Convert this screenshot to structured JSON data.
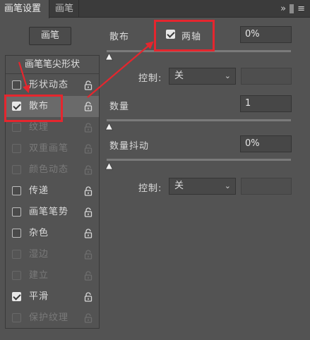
{
  "tabs": [
    {
      "label": "画笔设置",
      "active": true
    },
    {
      "label": "画笔",
      "active": false
    }
  ],
  "tabbar": {
    "collapse_icon": "double-chevron-right-icon",
    "menu_icon": "hamburger-menu-icon"
  },
  "brush_button": {
    "label": "画笔"
  },
  "tip_shape": {
    "label": "画笔笔尖形状"
  },
  "options": [
    {
      "label": "形状动态",
      "checked": false,
      "enabled": true
    },
    {
      "label": "散布",
      "checked": true,
      "enabled": true,
      "selected": true
    },
    {
      "label": "纹理",
      "checked": false,
      "enabled": false
    },
    {
      "label": "双重画笔",
      "checked": false,
      "enabled": false
    },
    {
      "label": "颜色动态",
      "checked": false,
      "enabled": false
    },
    {
      "label": "传递",
      "checked": false,
      "enabled": true
    },
    {
      "label": "画笔笔势",
      "checked": false,
      "enabled": true
    },
    {
      "label": "杂色",
      "checked": false,
      "enabled": true
    },
    {
      "label": "湿边",
      "checked": false,
      "enabled": false
    },
    {
      "label": "建立",
      "checked": false,
      "enabled": false
    },
    {
      "label": "平滑",
      "checked": true,
      "enabled": true
    },
    {
      "label": "保护纹理",
      "checked": false,
      "enabled": false
    }
  ],
  "scatter": {
    "label": "散布",
    "two_axis_label": "两轴",
    "two_axis_checked": true,
    "value": "0%",
    "control_label": "控制:",
    "control_value": "关"
  },
  "count": {
    "label": "数量",
    "value": "1"
  },
  "count_jitter": {
    "label": "数量抖动",
    "value": "0%",
    "control_label": "控制:",
    "control_value": "关"
  },
  "colors": {
    "annotation": "#e5262e",
    "panel_bg": "#535353",
    "selected_row": "#6a6a6a"
  }
}
